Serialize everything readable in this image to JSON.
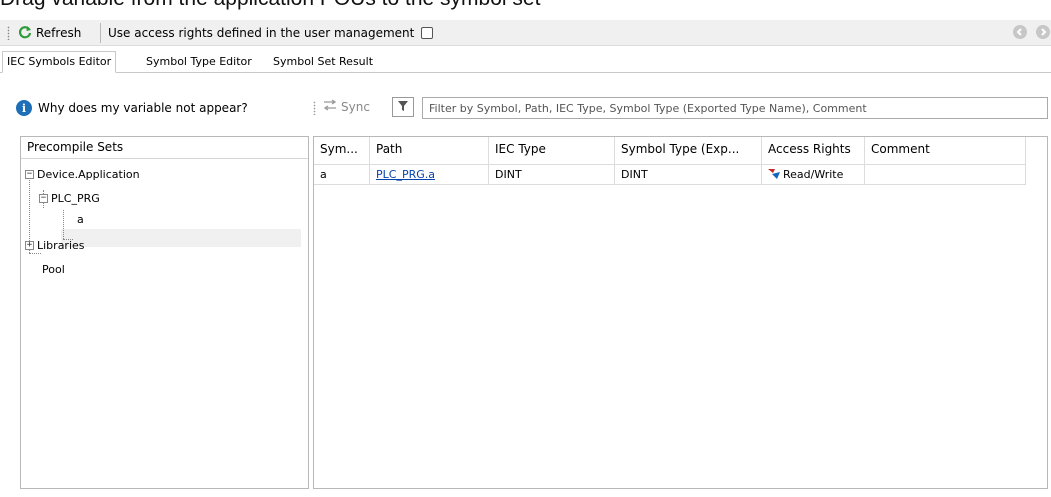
{
  "caption": "Drag variable from the application POUs to the symbol set",
  "toolbar": {
    "refresh_label": "Refresh",
    "access_rights_label": "Use access rights defined in the user management"
  },
  "tabs": [
    {
      "label": "IEC Symbols Editor"
    },
    {
      "label": "Symbol Type Editor"
    },
    {
      "label": "Symbol Set Result"
    }
  ],
  "help": {
    "label": "Why does my variable not appear?"
  },
  "sync": {
    "label": "Sync"
  },
  "filter": {
    "placeholder": "Filter by Symbol, Path, IEC Type, Symbol Type (Exported Type Name), Comment"
  },
  "left_panel": {
    "header": "Precompile Sets",
    "tree": [
      {
        "label": "Device.Application"
      },
      {
        "label": "PLC_PRG"
      },
      {
        "label": "a"
      },
      {
        "label": "Libraries"
      },
      {
        "label": "Pool"
      }
    ]
  },
  "grid": {
    "columns": [
      "Sym...",
      "Path",
      "IEC Type",
      "Symbol Type (Exp...",
      "Access Rights",
      "Comment"
    ],
    "rows": [
      {
        "symbol": "a",
        "path": "PLC_PRG.a",
        "iec_type": "DINT",
        "symbol_type": "DINT",
        "access": "Read/Write",
        "comment": ""
      }
    ]
  },
  "colors": {
    "accent": "#1f6fb8",
    "refresh_green": "#2e9a3a",
    "link": "#0645ad"
  }
}
